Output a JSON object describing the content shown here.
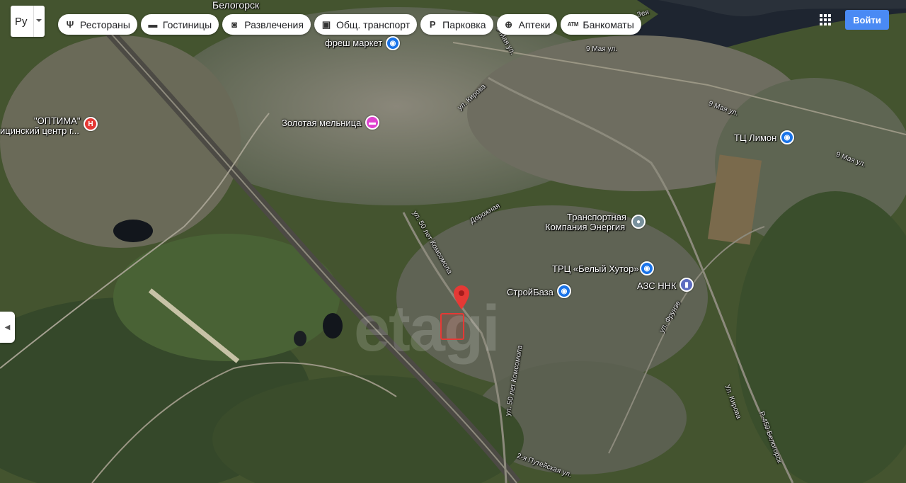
{
  "language": {
    "value": "Ру"
  },
  "chips": [
    {
      "label": "Рестораны",
      "icon": "restaurant-icon",
      "glyph": "Ψ"
    },
    {
      "label": "Гостиницы",
      "icon": "hotel-icon",
      "glyph": "▬"
    },
    {
      "label": "Развлечения",
      "icon": "camera-icon",
      "glyph": "◙"
    },
    {
      "label": "Общ. транспорт",
      "icon": "bus-icon",
      "glyph": "▣"
    },
    {
      "label": "Парковка",
      "icon": "parking-icon",
      "glyph": "P"
    },
    {
      "label": "Аптеки",
      "icon": "pharmacy-icon",
      "glyph": "⊕"
    },
    {
      "label": "Банкоматы",
      "icon": "atm-icon",
      "glyph": "ATM"
    }
  ],
  "header": {
    "signin_label": "Войти"
  },
  "map": {
    "city_label": "Белогорск",
    "watermark": "etagi",
    "places": [
      {
        "name": "фреш маркет",
        "type": "shopping",
        "color": "#1a73e8"
      },
      {
        "name": "Золотая мельница",
        "type": "hotel",
        "color": "#e042d0"
      },
      {
        "name": "\"ОПТИМА\"",
        "type": "medical",
        "color": "#e53935"
      },
      {
        "name": "ицинский центр г...",
        "type": "medical-text",
        "color": "#e53935"
      },
      {
        "name": "ТЦ Лимон",
        "type": "shopping",
        "color": "#1a73e8"
      },
      {
        "name": "Транспортная",
        "type": "place",
        "color": "#78909c"
      },
      {
        "name": "Компания Энергия",
        "type": "place-text",
        "color": "#78909c"
      },
      {
        "name": "ТРЦ «Белый Хутор»",
        "type": "shopping",
        "color": "#1a73e8"
      },
      {
        "name": "АЗС ННК",
        "type": "fuel",
        "color": "#5c6bc0"
      },
      {
        "name": "СтройБаза",
        "type": "shopping",
        "color": "#1a73e8"
      }
    ],
    "streets": [
      "9 Мая ул.",
      "9 Мая ул.",
      "ул. Кирова",
      "9 Мая ул.",
      "9 Мая ул.",
      "ул. 50 лет Комсомола",
      "Дорожная",
      "ул. 50 лет Комсомола",
      "2-я Путейская ул.",
      "ул. Фрунзе",
      "Р-459 Белогорск",
      "Ул. Кирова",
      "Зея"
    ],
    "colors": {
      "water": "#1b2330",
      "forest": "#3c5230",
      "urban": "#6b6a5c",
      "marker": "#e53935"
    }
  }
}
